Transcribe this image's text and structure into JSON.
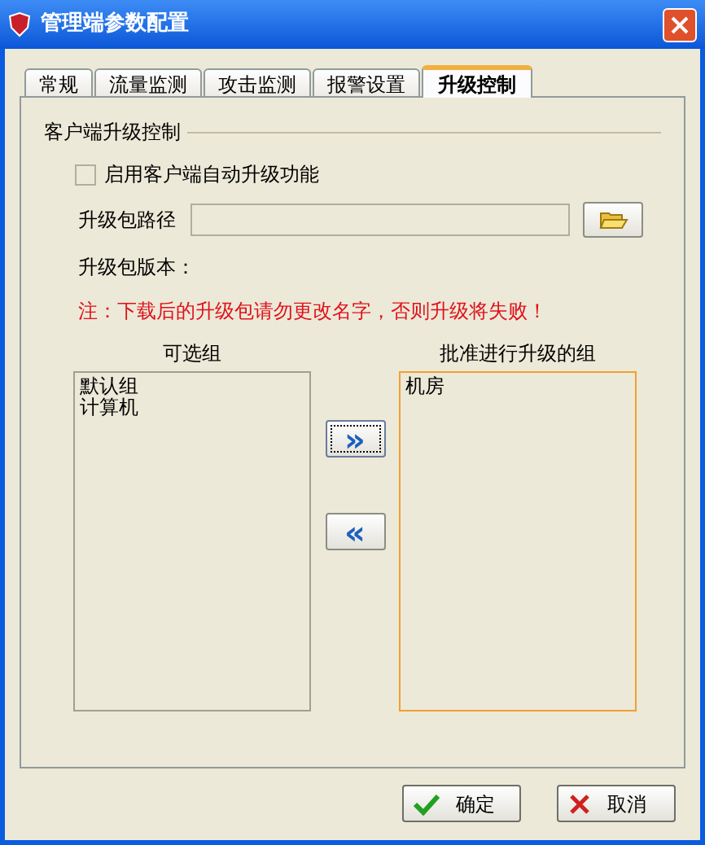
{
  "window": {
    "title": "管理端参数配置"
  },
  "tabs": [
    {
      "label": "常规",
      "selected": false
    },
    {
      "label": "流量监测",
      "selected": false
    },
    {
      "label": "攻击监测",
      "selected": false
    },
    {
      "label": "报警设置",
      "selected": false
    },
    {
      "label": "升级控制",
      "selected": true
    }
  ],
  "group": {
    "title": "客户端升级控制"
  },
  "auto_upgrade": {
    "label": "启用客户端自动升级功能",
    "checked": false
  },
  "package_path": {
    "label": "升级包路径"
  },
  "package_version": {
    "label": "升级包版本："
  },
  "note": "注：下载后的升级包请勿更改名字，否则升级将失败！",
  "available_groups": {
    "title": "可选组",
    "items": [
      "默认组",
      "计算机"
    ]
  },
  "approved_groups": {
    "title": "批准进行升级的组",
    "items": [
      "机房"
    ]
  },
  "move_buttons": [
    {
      "label": "»",
      "focused": true
    },
    {
      "label": "«",
      "focused": false
    }
  ],
  "buttons": [
    {
      "kind": "ok",
      "label": "确定"
    },
    {
      "kind": "cancel",
      "label": "取消"
    }
  ]
}
